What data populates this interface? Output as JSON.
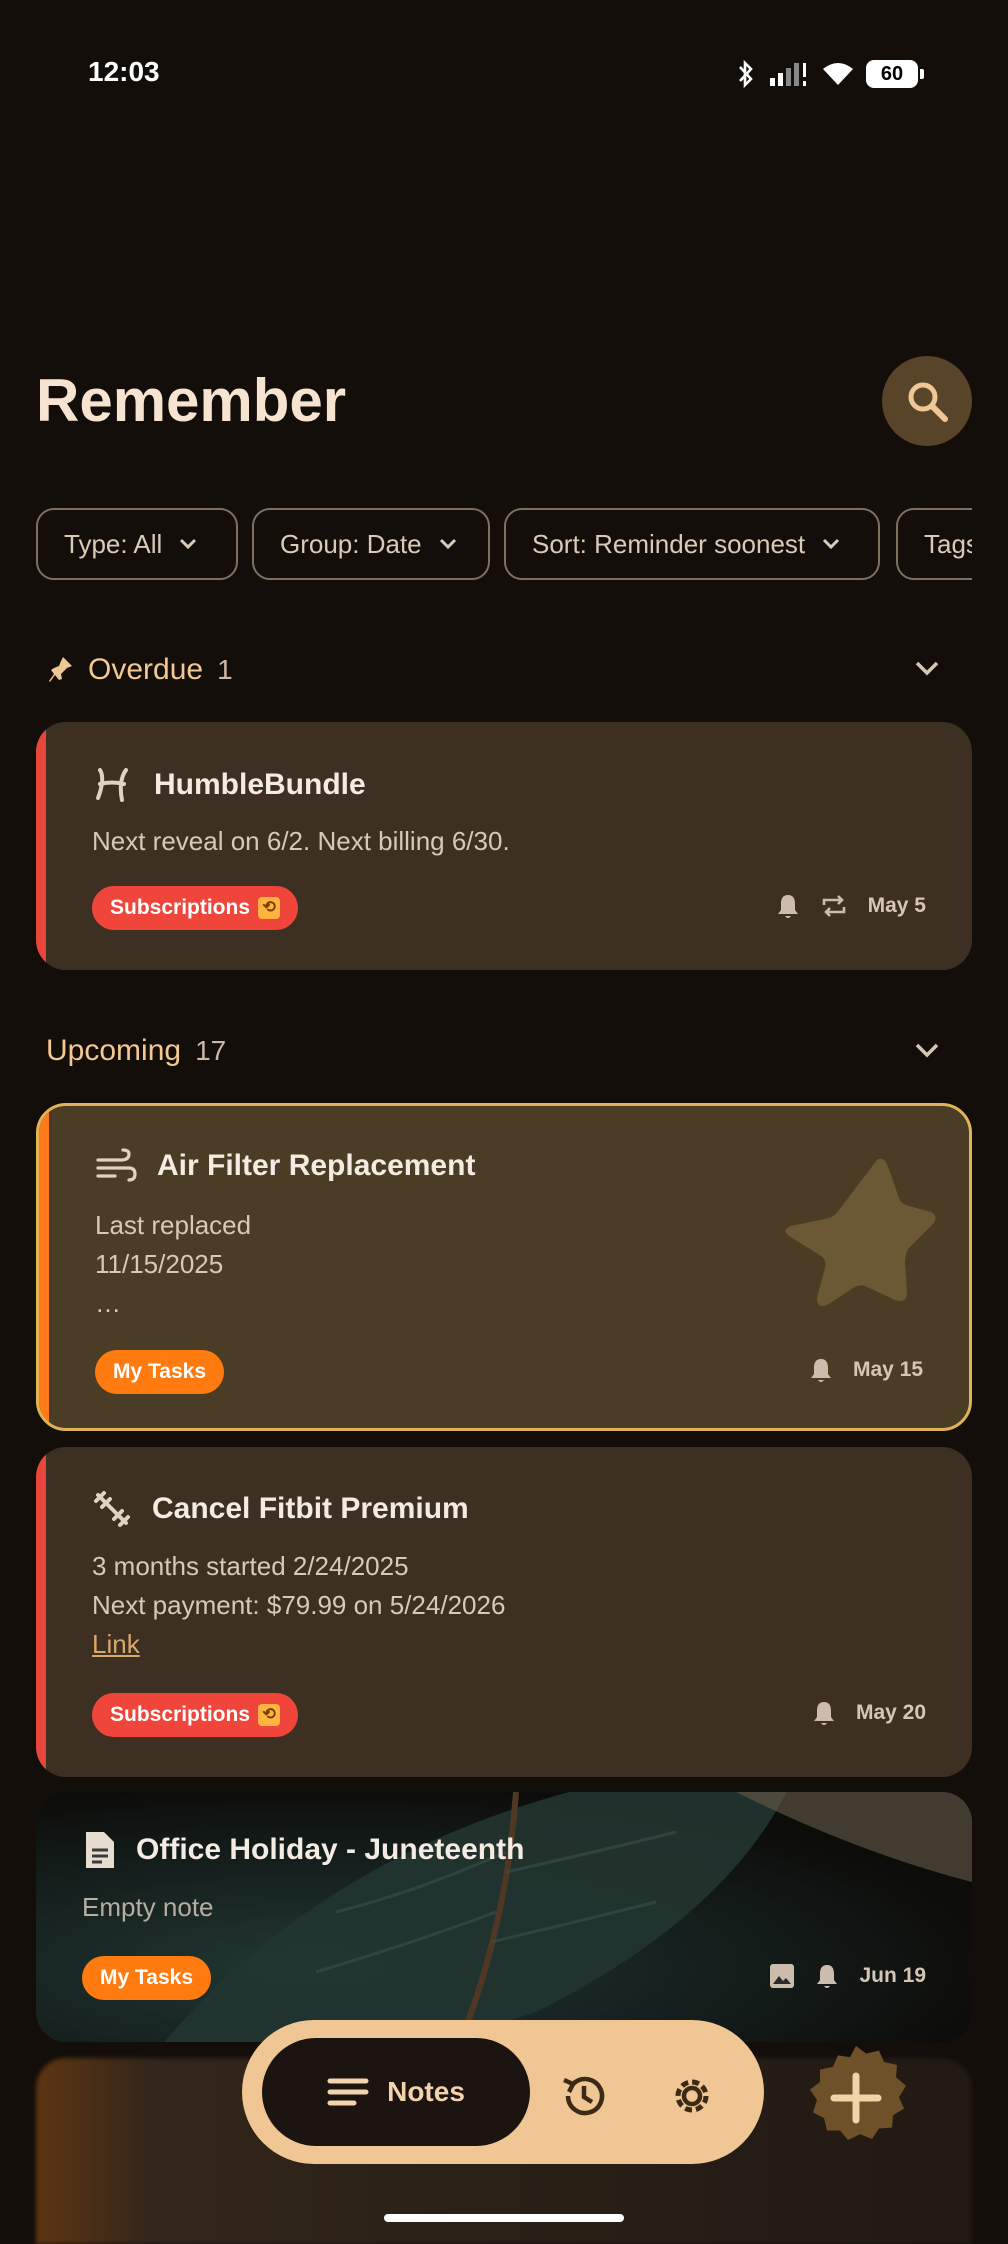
{
  "status_bar": {
    "time": "12:03",
    "battery": "60"
  },
  "header": {
    "title": "Remember"
  },
  "filters": [
    {
      "label": "Type: All"
    },
    {
      "label": "Group: Date"
    },
    {
      "label": "Sort: Reminder soonest"
    },
    {
      "label": "Tags"
    }
  ],
  "sections": {
    "overdue": {
      "title": "Overdue",
      "count": "1"
    },
    "upcoming": {
      "title": "Upcoming",
      "count": "17"
    }
  },
  "notes": [
    {
      "title": "HumbleBundle",
      "body": [
        "Next reveal on 6/2. Next billing 6/30."
      ],
      "tag": "Subscriptions",
      "date": "May 5",
      "stripe_color": "#e8463c",
      "tag_color": "#f0453a"
    },
    {
      "title": "Air Filter Replacement",
      "body": [
        "Last replaced",
        "11/15/2025",
        "…"
      ],
      "tag": "My Tasks",
      "date": "May 15",
      "stripe_color": "#ff7a1a",
      "tag_color": "#ff7a0f"
    },
    {
      "title": "Cancel Fitbit Premium",
      "body": [
        "3 months started 2/24/2025",
        "Next payment: $79.99 on 5/24/2026"
      ],
      "link": "Link",
      "tag": "Subscriptions",
      "date": "May 20",
      "stripe_color": "#e8463c",
      "tag_color": "#f0453a"
    },
    {
      "title": "Office Holiday - Juneteenth",
      "body": [
        "Empty note"
      ],
      "tag": "My Tasks",
      "date": "Jun 19",
      "tag_color": "#ff7a0f"
    }
  ],
  "bottom_nav": {
    "notes_label": "Notes"
  },
  "colors": {
    "background": "#130e0a",
    "card": "#3d3023",
    "accent": "#f0c694",
    "highlight_border": "#e0b454"
  }
}
